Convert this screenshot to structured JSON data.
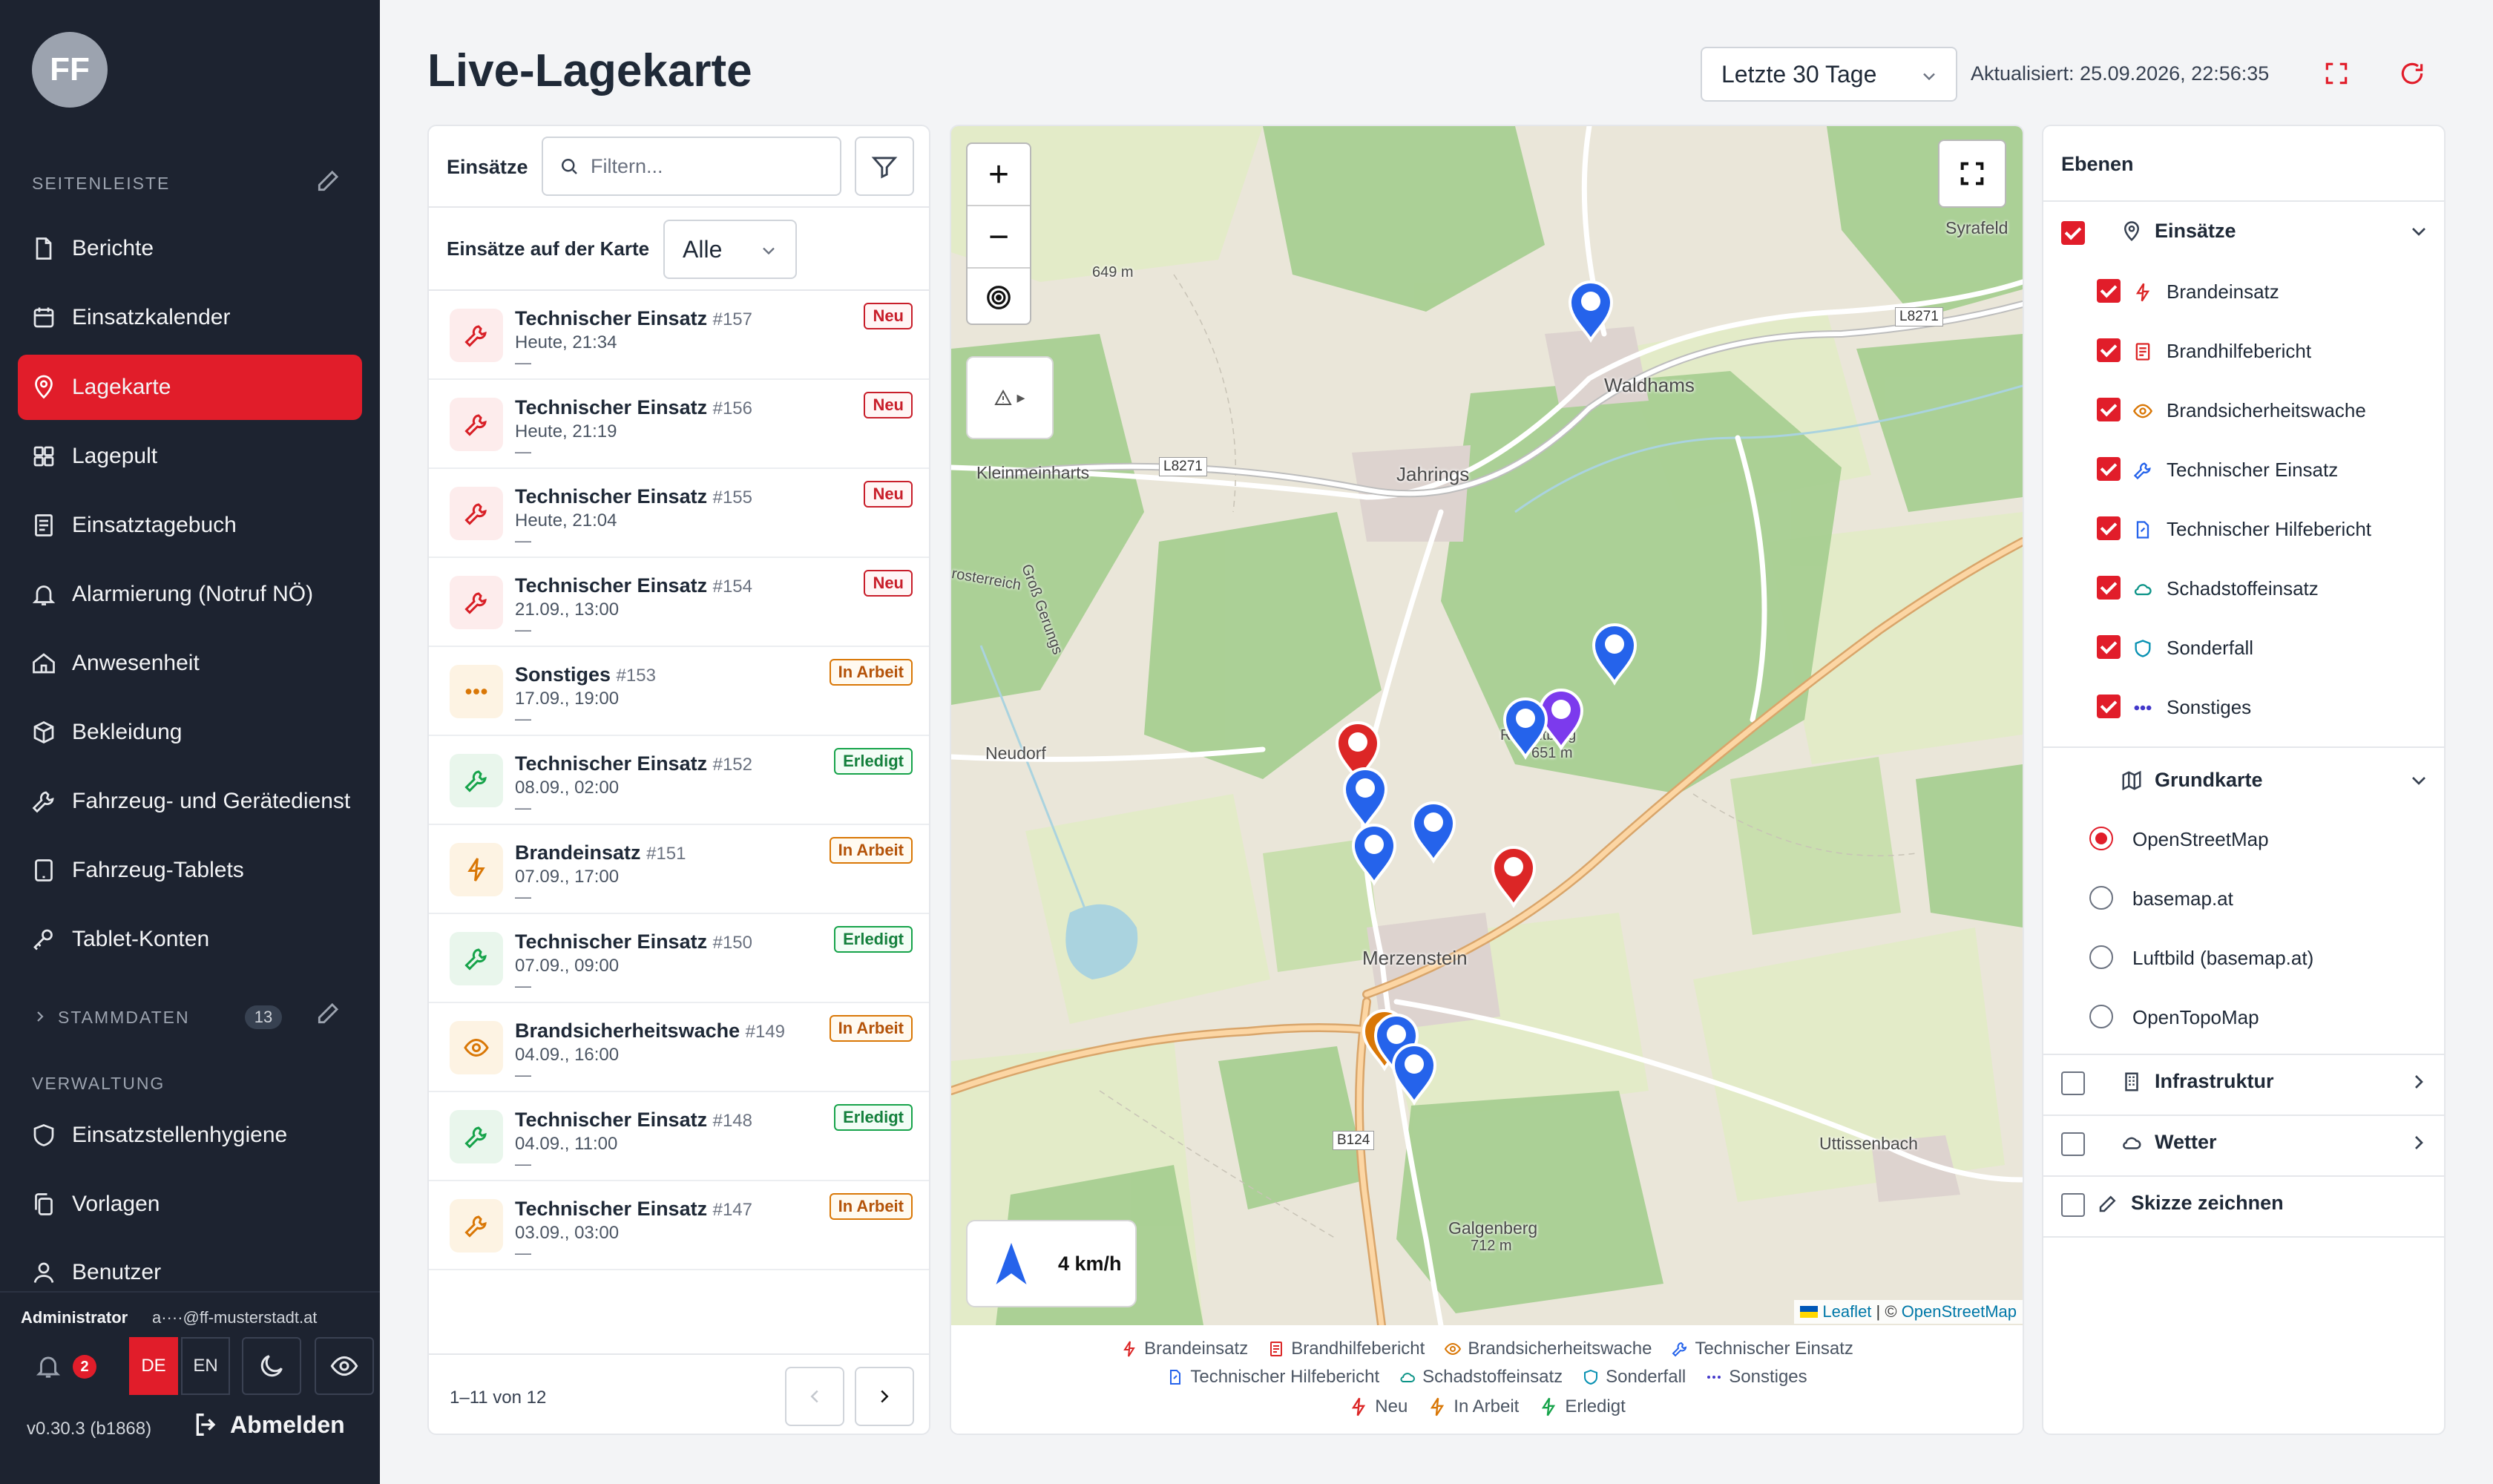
{
  "sidebar": {
    "avatar": "FF",
    "section_title": "SEITENLEISTE",
    "items": [
      {
        "label": "Berichte",
        "icon": "file-icon"
      },
      {
        "label": "Einsatzkalender",
        "icon": "calendar-icon"
      },
      {
        "label": "Lagekarte",
        "icon": "map-pin-icon",
        "active": true
      },
      {
        "label": "Lagepult",
        "icon": "grid-icon"
      },
      {
        "label": "Einsatztagebuch",
        "icon": "notebook-icon"
      },
      {
        "label": "Alarmierung (Notruf NÖ)",
        "icon": "bell-icon"
      },
      {
        "label": "Anwesenheit",
        "icon": "house-icon"
      },
      {
        "label": "Bekleidung",
        "icon": "box-icon"
      },
      {
        "label": "Fahrzeug- und Gerätedienst",
        "icon": "wrench-icon"
      },
      {
        "label": "Fahrzeug-Tablets",
        "icon": "tablet-icon"
      },
      {
        "label": "Tablet-Konten",
        "icon": "key-icon"
      }
    ],
    "stammdaten": {
      "label": "STAMMDATEN",
      "count": "13"
    },
    "verwaltung": {
      "label": "VERWALTUNG",
      "items": [
        {
          "label": "Einsatzstellenhygiene",
          "icon": "shield-icon"
        },
        {
          "label": "Vorlagen",
          "icon": "copy-icon"
        },
        {
          "label": "Benutzer",
          "icon": "user-icon"
        }
      ]
    },
    "footer": {
      "role": "Administrator",
      "email": "a····@ff-musterstadt.at",
      "notifications": "2",
      "lang_de": "DE",
      "lang_en": "EN",
      "version": "v0.30.3 (b1868)",
      "logout": "Abmelden"
    }
  },
  "header": {
    "title": "Live-Lagekarte",
    "range": "Letzte 30 Tage",
    "updated": "Aktualisiert: 25.09.2026, 22:56:35"
  },
  "list": {
    "label": "Einsätze",
    "search_placeholder": "Filtern...",
    "map_filter_label": "Einsätze auf der Karte",
    "map_filter_value": "Alle",
    "rows": [
      {
        "title": "Technischer Einsatz",
        "num": "#157",
        "time": "Heute, 21:34",
        "dash": "—",
        "status": "Neu",
        "kind": "tech",
        "state": "new"
      },
      {
        "title": "Technischer Einsatz",
        "num": "#156",
        "time": "Heute, 21:19",
        "dash": "—",
        "status": "Neu",
        "kind": "tech",
        "state": "new"
      },
      {
        "title": "Technischer Einsatz",
        "num": "#155",
        "time": "Heute, 21:04",
        "dash": "—",
        "status": "Neu",
        "kind": "tech",
        "state": "new"
      },
      {
        "title": "Technischer Einsatz",
        "num": "#154",
        "time": "21.09., 13:00",
        "dash": "—",
        "status": "Neu",
        "kind": "tech",
        "state": "new"
      },
      {
        "title": "Sonstiges",
        "num": "#153",
        "time": "17.09., 19:00",
        "dash": "—",
        "status": "In Arbeit",
        "kind": "other",
        "state": "work"
      },
      {
        "title": "Technischer Einsatz",
        "num": "#152",
        "time": "08.09., 02:00",
        "dash": "—",
        "status": "Erledigt",
        "kind": "tech",
        "state": "done"
      },
      {
        "title": "Brandeinsatz",
        "num": "#151",
        "time": "07.09., 17:00",
        "dash": "—",
        "status": "In Arbeit",
        "kind": "fire",
        "state": "work"
      },
      {
        "title": "Technischer Einsatz",
        "num": "#150",
        "time": "07.09., 09:00",
        "dash": "—",
        "status": "Erledigt",
        "kind": "tech",
        "state": "done"
      },
      {
        "title": "Brandsicherheitswache",
        "num": "#149",
        "time": "04.09., 16:00",
        "dash": "—",
        "status": "In Arbeit",
        "kind": "watch",
        "state": "work"
      },
      {
        "title": "Technischer Einsatz",
        "num": "#148",
        "time": "04.09., 11:00",
        "dash": "—",
        "status": "Erledigt",
        "kind": "tech",
        "state": "done"
      },
      {
        "title": "Technischer Einsatz",
        "num": "#147",
        "time": "03.09., 03:00",
        "dash": "—",
        "status": "In Arbeit",
        "kind": "tech",
        "state": "work"
      }
    ],
    "pager": "1–11 von 12"
  },
  "map": {
    "speed": "4 km/h",
    "attribution_leaflet": "Leaflet",
    "attribution_sep": " | © ",
    "attribution_osm": "OpenStreetMap",
    "warn_label": "▸",
    "places": [
      "Syrafeld",
      "Waldhams",
      "Jahrings",
      "Kleinmeinharts",
      "Neudorf",
      "Merzenstein",
      "Uttissenbach",
      "Galgenberg",
      "712 m",
      "649 m",
      "651 m",
      "Roßwitberg",
      "Groß Gerungs",
      "rosterreich"
    ],
    "roads": [
      "L8271",
      "L8271",
      "B124"
    ],
    "legend": {
      "row1": [
        "Brandeinsatz",
        "Brandhilfebericht",
        "Brandsicherheitswache",
        "Technischer Einsatz"
      ],
      "row2": [
        "Technischer Hilfebericht",
        "Schadstoffeinsatz",
        "Sonderfall",
        "Sonstiges"
      ],
      "row3": [
        "Neu",
        "In Arbeit",
        "Erledigt"
      ]
    },
    "colors": {
      "new": "#d81f26",
      "work": "#d97706",
      "done": "#16a34a",
      "tech_marker": "#2563eb",
      "fire_marker": "#dc2626",
      "other_marker": "#7c3aed"
    }
  },
  "layers": {
    "title": "Ebenen",
    "einsaetze": {
      "label": "Einsätze",
      "items": [
        "Brandeinsatz",
        "Brandhilfebericht",
        "Brandsicherheitswache",
        "Technischer Einsatz",
        "Technischer Hilfebericht",
        "Schadstoffeinsatz",
        "Sonderfall",
        "Sonstiges"
      ]
    },
    "grundkarte": {
      "label": "Grundkarte",
      "options": [
        "OpenStreetMap",
        "basemap.at",
        "Luftbild (basemap.at)",
        "OpenTopoMap"
      ],
      "selected": "OpenStreetMap"
    },
    "infrastruktur": "Infrastruktur",
    "wetter": "Wetter",
    "skizze": "Skizze zeichnen"
  }
}
